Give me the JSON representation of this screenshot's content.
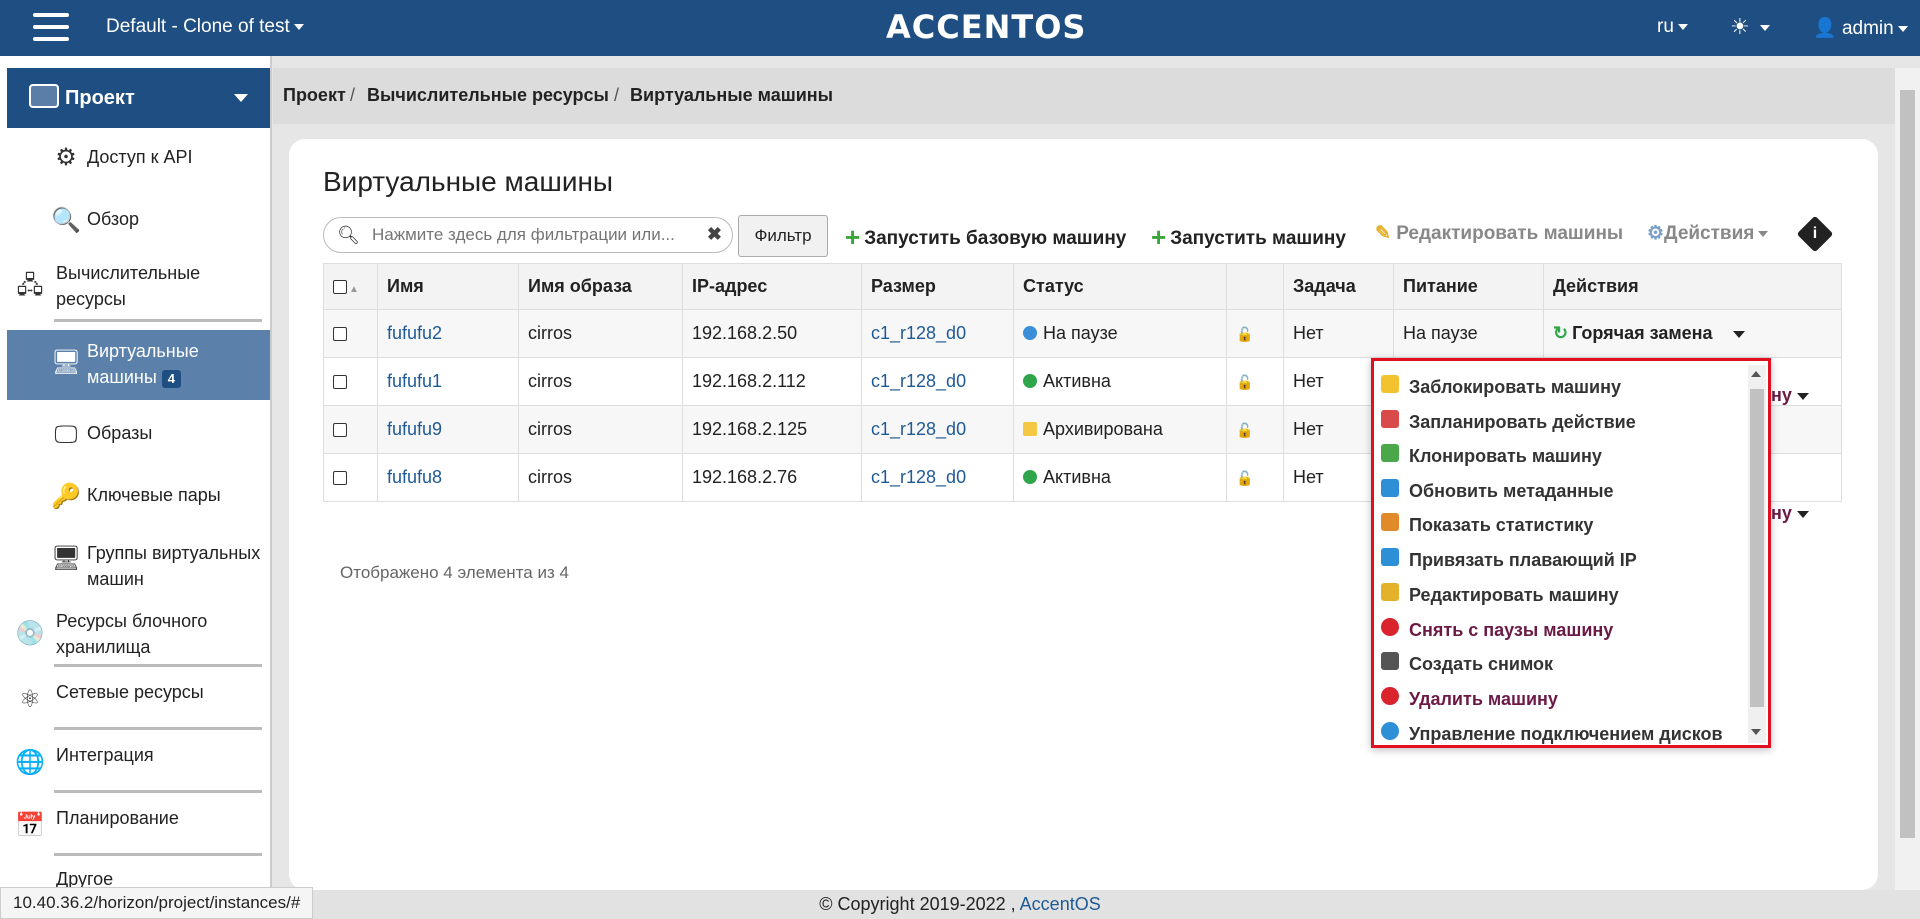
{
  "topbar": {
    "project": "Default - Clone of test",
    "brand": "ACCENTOS",
    "lang": "ru",
    "user": "admin"
  },
  "sidebar": {
    "header": "Проект",
    "items": [
      {
        "label": "Доступ к API"
      },
      {
        "label": "Обзор"
      },
      {
        "label": "Вычислительные ресурсы"
      },
      {
        "label": "Виртуальные машины",
        "badge": "4"
      },
      {
        "label": "Образы"
      },
      {
        "label": "Ключевые пары"
      },
      {
        "label": "Группы виртуальных машин"
      },
      {
        "label": "Ресурсы блочного хранилища"
      },
      {
        "label": "Сетевые ресурсы"
      },
      {
        "label": "Интеграция"
      },
      {
        "label": "Планирование"
      },
      {
        "label": "Другое"
      }
    ]
  },
  "breadcrumb": [
    "Проект",
    "Вычислительные ресурсы",
    "Виртуальные машины"
  ],
  "page_title": "Виртуальные машины",
  "search": {
    "placeholder": "Нажмите здесь для фильтрации или..."
  },
  "filter_label": "Фильтр",
  "toolbar": {
    "launch_base": "Запустить базовую машину",
    "launch": "Запустить машину",
    "edit": "Редактировать машины",
    "actions": "Действия"
  },
  "table": {
    "headers": [
      "Имя",
      "Имя образа",
      "IP-адрес",
      "Размер",
      "Статус",
      "",
      "Задача",
      "Питание",
      "Действия"
    ],
    "rows": [
      {
        "name": "fufufu2",
        "image": "cirros",
        "ip": "192.168.2.50",
        "size": "c1_r128_d0",
        "status": "На паузе",
        "status_type": "pause",
        "task": "Нет",
        "power": "На паузе",
        "action": "Горячая замена"
      },
      {
        "name": "fufufu1",
        "image": "cirros",
        "ip": "192.168.2.112",
        "size": "c1_r128_d0",
        "status": "Активна",
        "status_type": "ok",
        "task": "Нет",
        "power": "",
        "action": ""
      },
      {
        "name": "fufufu9",
        "image": "cirros",
        "ip": "192.168.2.125",
        "size": "c1_r128_d0",
        "status": "Архивирована",
        "status_type": "arch",
        "task": "Нет",
        "power": "",
        "action": ""
      },
      {
        "name": "fufufu8",
        "image": "cirros",
        "ip": "192.168.2.76",
        "size": "c1_r128_d0",
        "status": "Активна",
        "status_type": "ok",
        "task": "Нет",
        "power": "",
        "action": ""
      }
    ],
    "fragment": "ну"
  },
  "count_text": "Отображено 4 элемента из 4",
  "menu": {
    "items": [
      {
        "label": "Заблокировать машину",
        "icon": "lock-icon",
        "color": "#f2c230",
        "danger": false
      },
      {
        "label": "Запланировать действие",
        "icon": "calendar-icon",
        "color": "#d94a4a",
        "danger": false
      },
      {
        "label": "Клонировать машину",
        "icon": "clone-icon",
        "color": "#4aa84a",
        "danger": false
      },
      {
        "label": "Обновить метаданные",
        "icon": "tag-icon",
        "color": "#2d8fd6",
        "danger": false
      },
      {
        "label": "Показать статистику",
        "icon": "chart-icon",
        "color": "#e08a2a",
        "danger": false
      },
      {
        "label": "Привязать плавающий IP",
        "icon": "ip-icon",
        "color": "#2d8fd6",
        "danger": false
      },
      {
        "label": "Редактировать машину",
        "icon": "pencil-icon",
        "color": "#e3b22a",
        "danger": false
      },
      {
        "label": "Снять с паузы машину",
        "icon": "pause-icon",
        "color": "#d9232d",
        "danger": true
      },
      {
        "label": "Создать снимок",
        "icon": "camera-icon",
        "color": "#555555",
        "danger": false
      },
      {
        "label": "Удалить машину",
        "icon": "trash-icon",
        "color": "#d9232d",
        "danger": true
      },
      {
        "label": "Управление подключением дисков",
        "icon": "disk-icon",
        "color": "#2d8fd6",
        "danger": false
      }
    ]
  },
  "footer": {
    "copyright": "© Copyright 2019-2022 ,",
    "link": "AccentOS"
  },
  "status_url": "10.40.36.2/horizon/project/instances/#"
}
